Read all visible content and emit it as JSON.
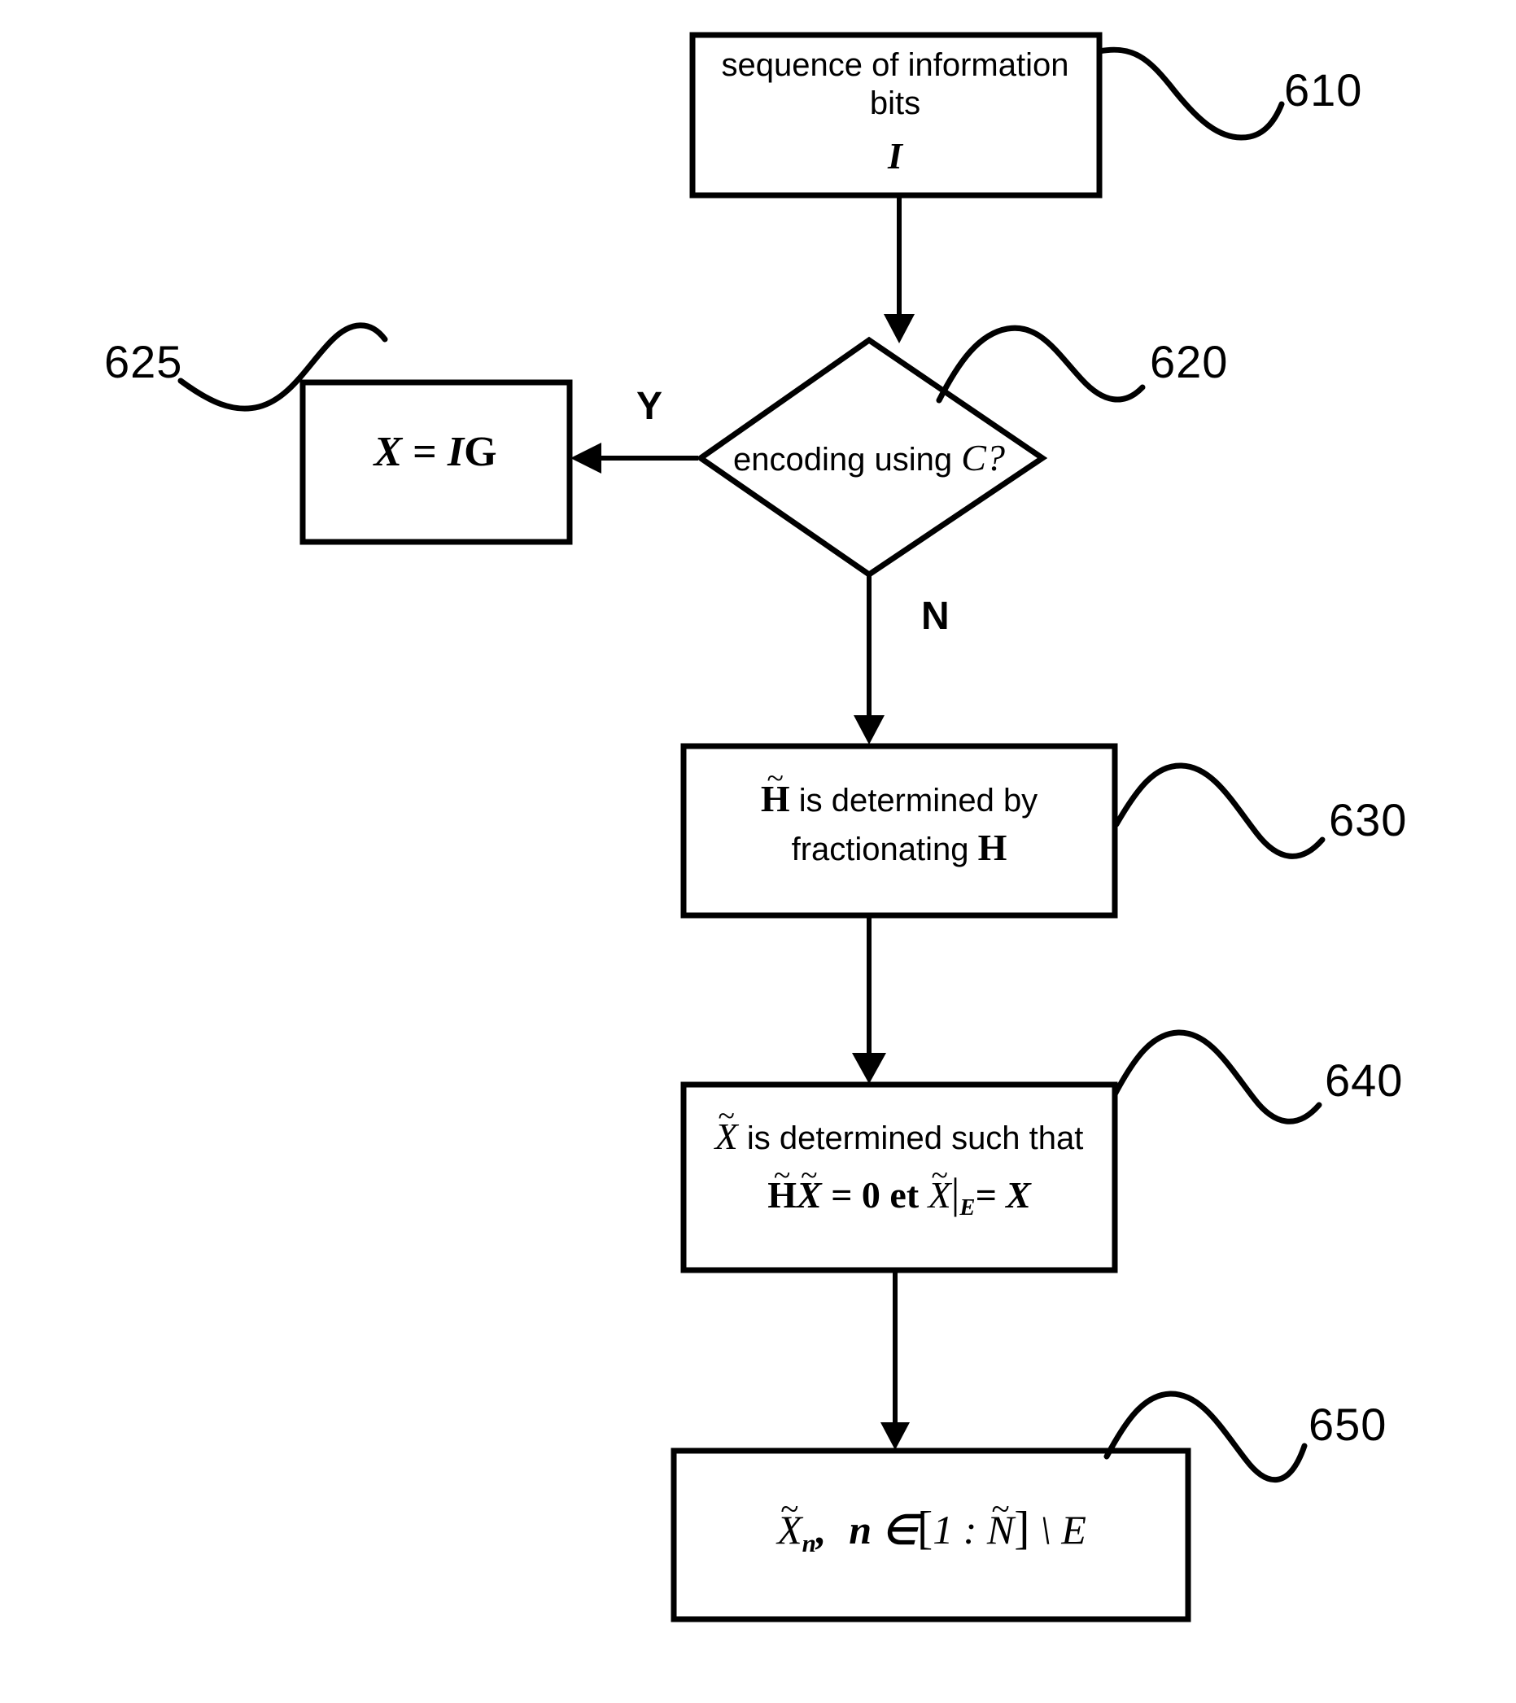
{
  "figure": {
    "title": "Encoding flowchart",
    "stroke_color": "#000000",
    "background_color": "#ffffff"
  },
  "nodes": {
    "n610": {
      "ref": "610",
      "type": "process",
      "line1": "sequence of information",
      "line2": "bits",
      "symbol": "I"
    },
    "n620": {
      "ref": "620",
      "type": "decision",
      "text_prefix": "encoding using ",
      "symbol": "C",
      "text_suffix": "?"
    },
    "n625": {
      "ref": "625",
      "type": "process",
      "equation_lhs": "X",
      "equation_eq": " = ",
      "equation_rhs_i": "I",
      "equation_rhs_g": "G"
    },
    "n630": {
      "ref": "630",
      "type": "process",
      "line1_symbol": "H",
      "line1_text": " is determined by",
      "line2_text": "fractionating ",
      "line2_symbol": "H"
    },
    "n640": {
      "ref": "640",
      "type": "process",
      "line1_symbol": "X",
      "line1_text": " is determined such that",
      "line2_h": "H",
      "line2_x1": "X",
      "line2_eq0": " = 0 et ",
      "line2_x2": "X",
      "line2_bar": "|",
      "line2_sub": "E",
      "line2_eqx": "= X"
    },
    "n650": {
      "ref": "650",
      "type": "process",
      "symbol_x": "X",
      "symbol_sub": "n",
      "comma": ",",
      "member": "n ∈",
      "bracket_open": "[",
      "range": "1 : ",
      "range_n": "N",
      "bracket_close": "]",
      "setminus": " \\ ",
      "excluded": "E"
    }
  },
  "edges": {
    "yes_label": "Y",
    "no_label": "N"
  },
  "reference_numerals": {
    "r610": "610",
    "r620": "620",
    "r625": "625",
    "r630": "630",
    "r640": "640",
    "r650": "650"
  }
}
